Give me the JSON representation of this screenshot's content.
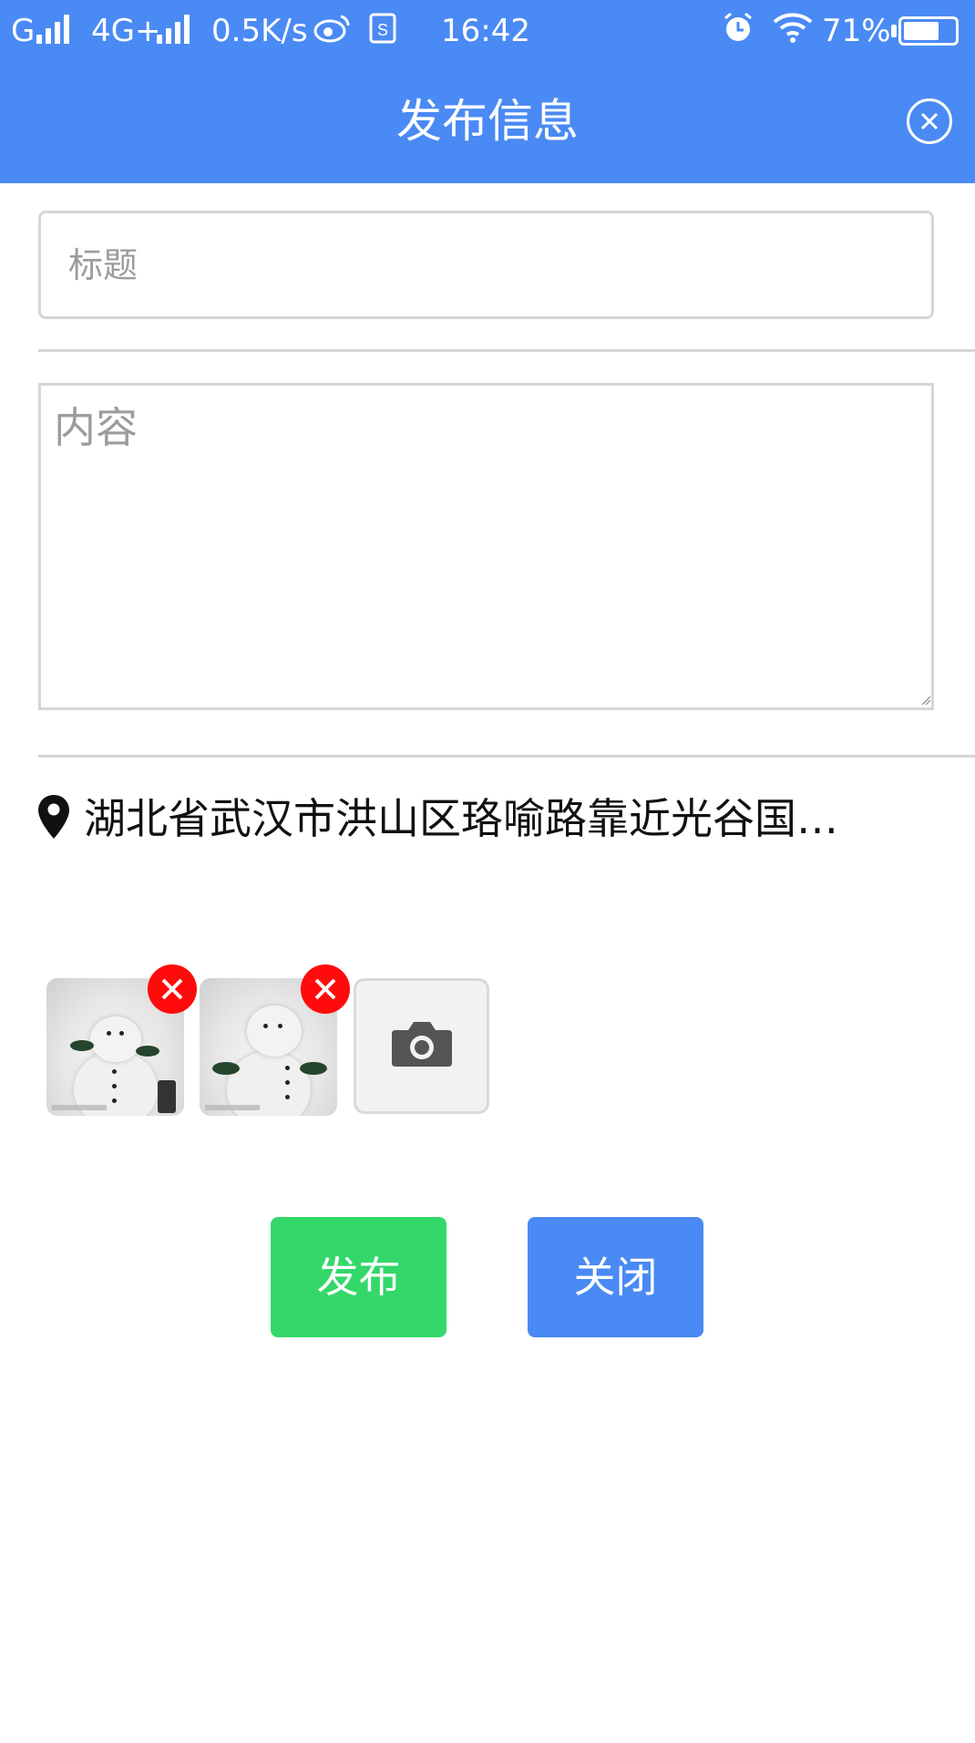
{
  "status_bar": {
    "carrier1": "G",
    "carrier2": "4G+",
    "speed": "0.5K/s",
    "time": "16:42",
    "battery_text": "71%",
    "battery_level": 0.71
  },
  "header": {
    "title": "发布信息"
  },
  "form": {
    "title_placeholder": "标题",
    "content_placeholder": "内容",
    "location": "湖北省武汉市洪山区珞喻路靠近光谷国…"
  },
  "photos": {
    "items": [
      {
        "description": "snowman photo 1"
      },
      {
        "description": "snowman photo 2"
      }
    ]
  },
  "actions": {
    "publish_label": "发布",
    "close_label": "关闭"
  },
  "colors": {
    "accent": "#4a8af4",
    "publish": "#34d86a",
    "remove": "#ff0b0b"
  }
}
